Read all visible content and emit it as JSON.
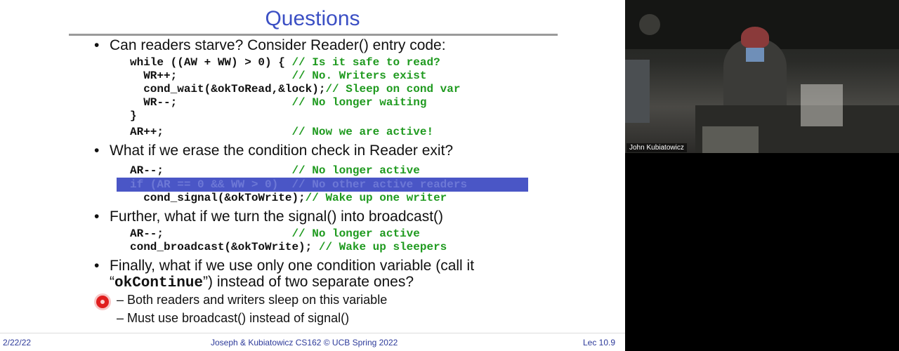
{
  "slide": {
    "title": "Questions",
    "bullets": {
      "b1": "Can readers starve?  Consider Reader() entry code:",
      "b2": "What if we erase the condition check in Reader exit?",
      "b3": "Further, what if we turn the signal() into broadcast()",
      "b4_line1": "Finally, what if we use only one condition variable (call it",
      "b4_line2_open": "“",
      "b4_line2_code": "okContinue",
      "b4_line2_rest": "”) instead of two separate ones?",
      "bullet_symbol": "•"
    },
    "code1": {
      "l1_code": "while ((AW + WW) > 0) { ",
      "l1_cmt": "// Is it safe to read?",
      "l2_code": "  WR++;                 ",
      "l2_cmt": "// No. Writers exist",
      "l3_code": "  cond_wait(&okToRead,&lock);",
      "l3_cmt": "// Sleep on cond var",
      "l4_code": "  WR--;                 ",
      "l4_cmt": "// No longer waiting",
      "l5_code": "}",
      "l6_code": "AR++;                   ",
      "l6_cmt": "// Now we are active!"
    },
    "code2": {
      "l1_code": "AR--;                   ",
      "l1_cmt": "// No longer active",
      "l2_highlighted": "if (AR == 0 && WW > 0)  // No other active readers",
      "l3_code": "  cond_signal(&okToWrite);",
      "l3_cmt": "// Wake up one writer"
    },
    "code3": {
      "l1_code": "AR--;                   ",
      "l1_cmt": "// No longer active",
      "l2_code": "cond_broadcast(&okToWrite); ",
      "l2_cmt": "// Wake up sleepers"
    },
    "subbullets": {
      "s1": "– Both readers and writers sleep on this variable",
      "s2": "– Must use broadcast() instead of signal()"
    },
    "footer": {
      "date": "2/22/22",
      "course": "Joseph & Kubiatowicz CS162 © UCB Spring 2022",
      "lecture": "Lec 10.9"
    }
  },
  "video": {
    "presenter_name": "John Kubiatowicz"
  },
  "colors": {
    "title": "#3b4fc4",
    "comment": "#1f9a1f",
    "highlight": "#4a56c6",
    "pointer": "#e01e1e"
  }
}
